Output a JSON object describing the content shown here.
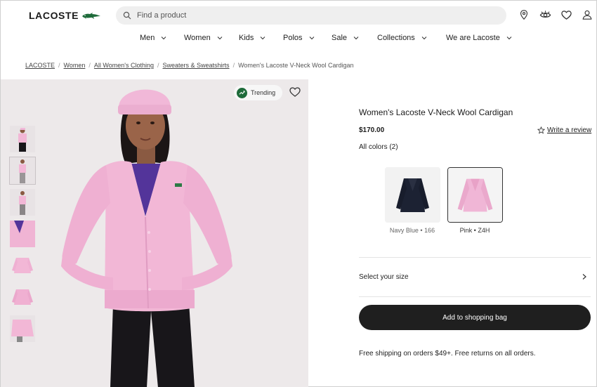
{
  "header": {
    "logo_text": "LACOSTE",
    "search_placeholder": "Find a product",
    "icons": [
      "location-icon",
      "eye-icon",
      "heart-icon",
      "account-icon"
    ]
  },
  "nav": {
    "items": [
      "Men",
      "Women",
      "Kids",
      "Polos",
      "Sale",
      "Collections",
      "We are Lacoste"
    ]
  },
  "breadcrumb": {
    "items": [
      "LACOSTE",
      "Women",
      "All Women's Clothing",
      "Sweaters & Sweatshirts"
    ],
    "current": "Women's Lacoste V-Neck Wool Cardigan"
  },
  "gallery": {
    "trending_label": "Trending",
    "thumbnail_count": 7,
    "active_thumbnail": 1
  },
  "product": {
    "title": "Women's Lacoste V-Neck Wool Cardigan",
    "price": "$170.00",
    "review_label": "Write a review",
    "colors_label": "All colors (2)",
    "colors": [
      {
        "label": "Navy Blue • 166",
        "hex": "#1c2233",
        "selected": false
      },
      {
        "label": "Pink • Z4H",
        "hex": "#f0b6d6",
        "selected": true
      }
    ],
    "size_label": "Select your size",
    "add_button": "Add to shopping bag",
    "shipping_text": "Free shipping on orders $49+. Free returns on all orders."
  },
  "colors": {
    "brand_green": "#1e6b3a",
    "button_dark": "#1f1f1f",
    "cardigan_pink": "#f0b6d6",
    "search_bg": "#efefef"
  }
}
